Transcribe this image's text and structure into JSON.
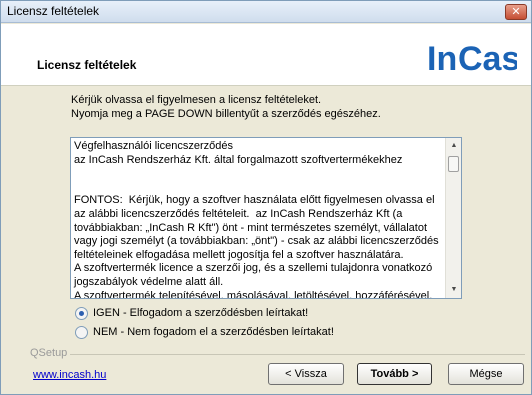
{
  "window": {
    "title": "Licensz feltételek",
    "close_glyph": "✕"
  },
  "header": {
    "title": "Licensz feltételek",
    "logo_text_a": "In",
    "logo_text_b": "Cash",
    "logo_color": "#1b63b5"
  },
  "instructions": {
    "line1": "Kérjük olvassa el figyelmesen a licensz feltételeket.",
    "line2": "Nyomja meg a PAGE DOWN billentyűt a szerződés egészéhez."
  },
  "license": {
    "text": "Végfelhasználói licencszerződés\naz InCash Rendszerház Kft. által forgalmazott szoftvertermékekhez\n\n\nFONTOS:  Kérjük, hogy a szoftver használata előtt figyelmesen olvassa el az alábbi licencszerződés feltételeit.  az InCash Rendszerház Kft (a továbbiakban: „InCash R Kft\") önt - mint természetes személyt, vállalatot vagy jogi személyt (a továbbiakban: „önt\") - csak az alábbi licencszerződés feltételeinek elfogadása mellett jogosítja fel a szoftver használatára.\nA szoftvertermék licence a szerzői jog, és a szellemi tulajdonra vonatkozó jogszabályok védelme alatt áll.\nA szoftvertermék telepítésével, másolásával, letöltésével, hozzáférésével,"
  },
  "options": {
    "accept": "IGEN - Elfogadom a szerződésben leírtakat!",
    "decline": "NEM - Nem fogadom el a szerződésben leírtakat!",
    "selected": "accept"
  },
  "footer": {
    "group_label": "QSetup",
    "link": "www.incash.hu",
    "back_label": "< Vissza",
    "next_label": "Tovább >",
    "cancel_label": "Mégse"
  }
}
